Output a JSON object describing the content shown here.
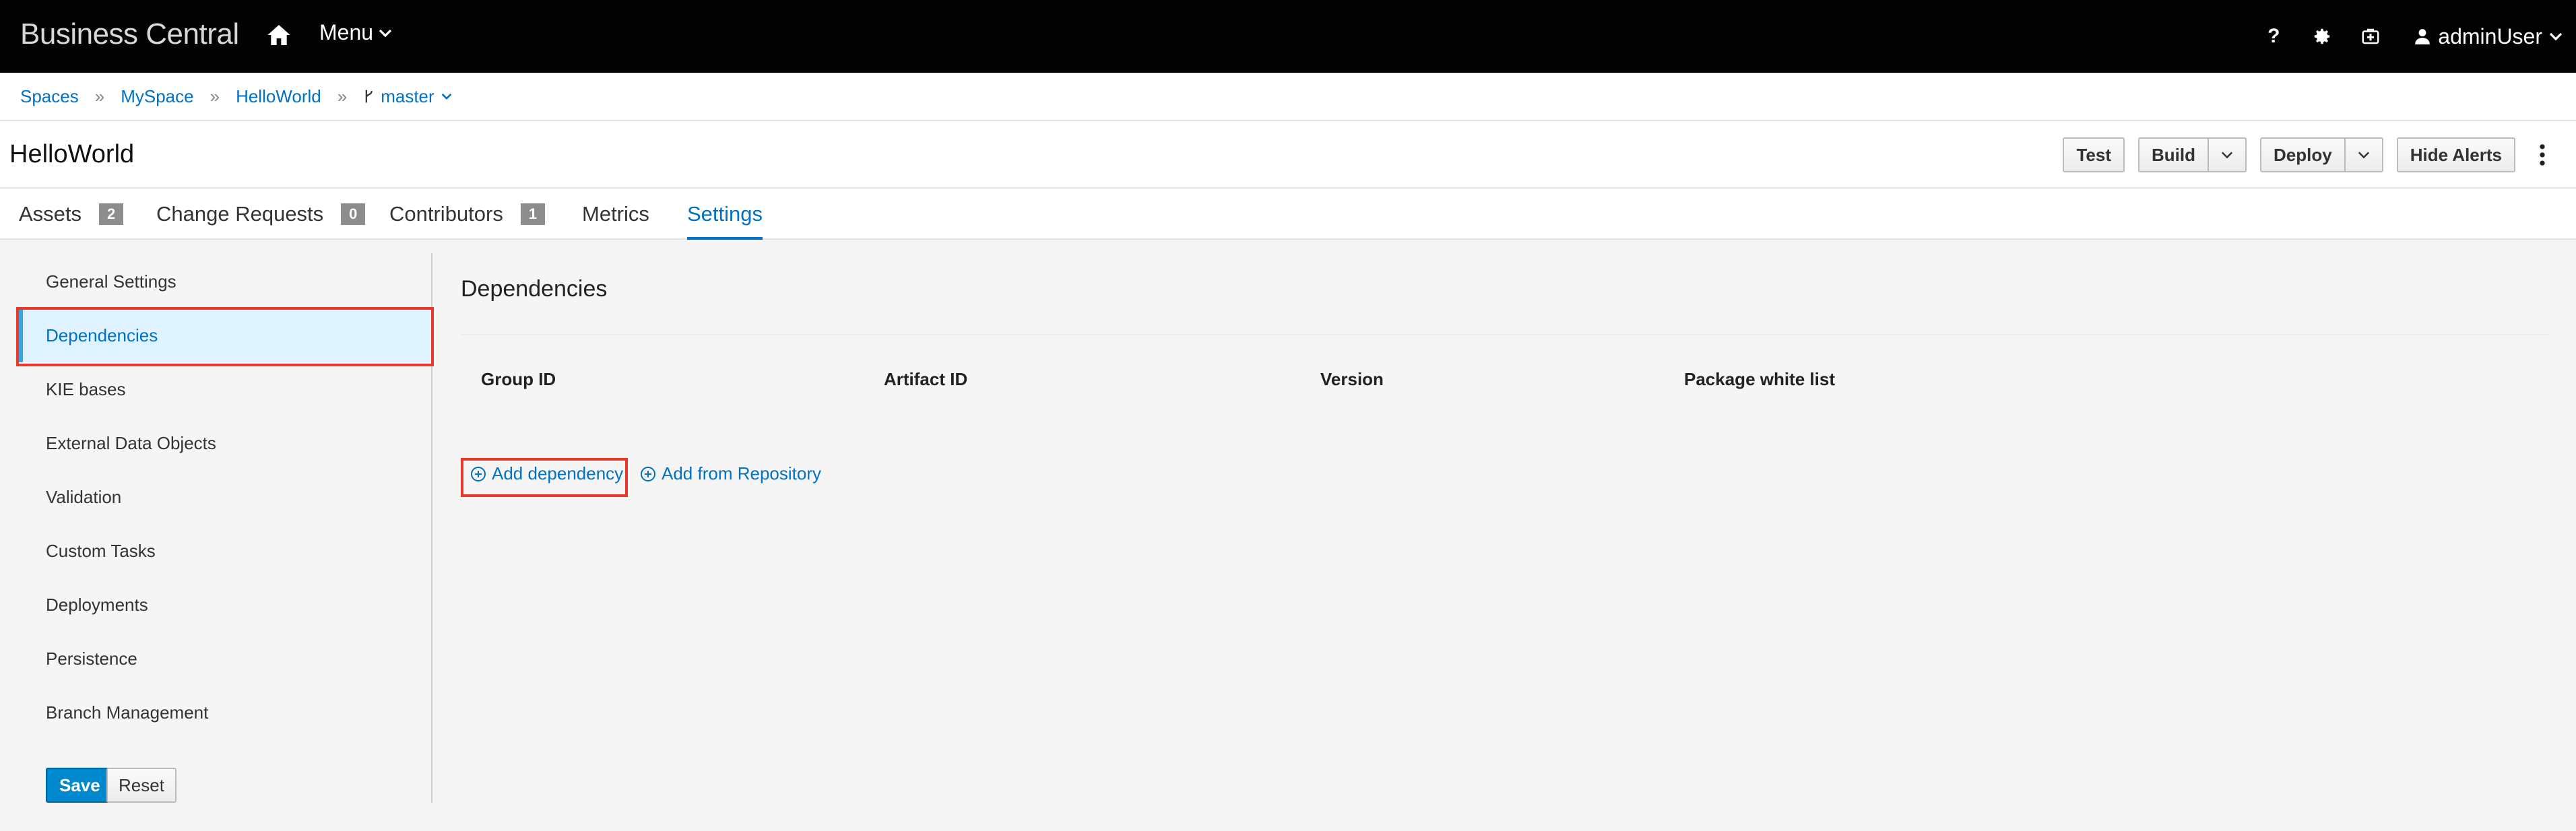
{
  "app": {
    "brand": "Business Central"
  },
  "nav": {
    "menu_label": "Menu",
    "user_label": "adminUser",
    "help_glyph": "?"
  },
  "breadcrumb": {
    "items": [
      "Spaces",
      "MySpace",
      "HelloWorld"
    ],
    "branch": "master"
  },
  "header": {
    "title": "HelloWorld"
  },
  "toolbar": {
    "test": "Test",
    "build": "Build",
    "deploy": "Deploy",
    "hide_alerts": "Hide Alerts"
  },
  "tabs": [
    {
      "label": "Assets",
      "badge": "2"
    },
    {
      "label": "Change Requests",
      "badge": "0"
    },
    {
      "label": "Contributors",
      "badge": "1"
    },
    {
      "label": "Metrics"
    },
    {
      "label": "Settings",
      "active": true
    }
  ],
  "sidebar": {
    "items": [
      {
        "label": "General Settings"
      },
      {
        "label": "Dependencies",
        "active": true
      },
      {
        "label": "KIE bases"
      },
      {
        "label": "External Data Objects"
      },
      {
        "label": "Validation"
      },
      {
        "label": "Custom Tasks"
      },
      {
        "label": "Deployments"
      },
      {
        "label": "Persistence"
      },
      {
        "label": "Branch Management"
      }
    ],
    "save": "Save",
    "reset": "Reset"
  },
  "main": {
    "title": "Dependencies",
    "columns": [
      "Group ID",
      "Artifact ID",
      "Version",
      "Package white list"
    ],
    "add_dependency": "Add dependency",
    "add_from_repository": "Add from Repository"
  },
  "colors": {
    "accent": "#0071c5",
    "highlight": "#e8392d",
    "topbar": "#030303",
    "active_bg": "#def3ff"
  }
}
